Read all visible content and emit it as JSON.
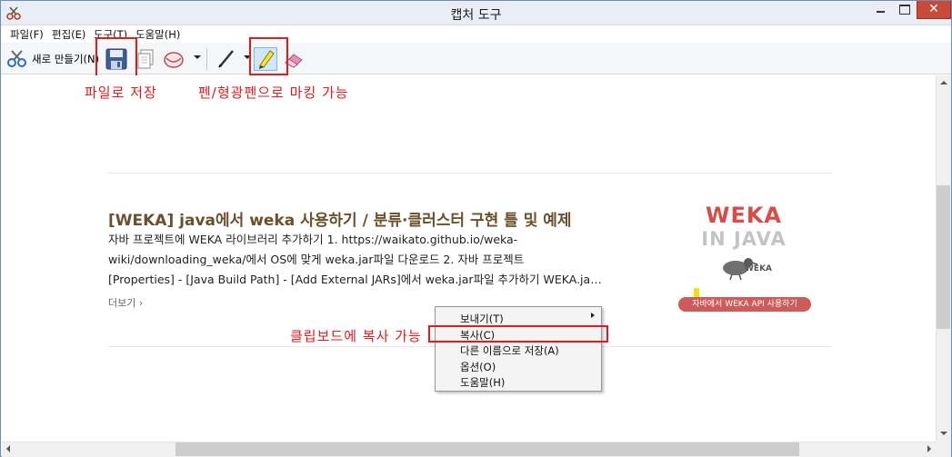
{
  "window": {
    "title": "캡처 도구",
    "close_glyph": "✕"
  },
  "menu": {
    "items": [
      "파일(F)",
      "편집(E)",
      "도구(T)",
      "도움말(H)"
    ]
  },
  "toolbar": {
    "new_label": "새로 만들기(N)"
  },
  "annotations": {
    "save_note": "파일로 저장",
    "pen_note": "펜/형광펜으로 마킹 가능",
    "clipboard_note": "클립보드에 복사 가능"
  },
  "post": {
    "title": "[WEKA] java에서 weka 사용하기 / 분류·클러스터 구현 틀 및 예제",
    "lines": [
      "자바 프로젝트에 WEKA 라이브러리 추가하기 1. https://waikato.github.io/weka-",
      "wiki/downloading_weka/에서 OS에 맞게 weka.jar파일 다운로드 2. 자바 프로젝트",
      "[Properties] - [Java Build Path] - [Add External JARs]에서 weka.jar파일 추가하기 WEKA.ja…"
    ],
    "more_link": "더보기 ›",
    "thumbnail": {
      "title_top": "WEKA",
      "title_bottom": "IN JAVA",
      "logo_label": "WEKA",
      "banner": "자바에서 WEKA API 사용하기"
    }
  },
  "context_menu": {
    "items": [
      "보내기(T)",
      "복사(C)",
      "다른 이름으로 저장(A)",
      "옵션(O)",
      "도움말(H)"
    ]
  },
  "colors": {
    "annotation": "#e5191c",
    "post_title": "#6b4f2a",
    "weka_red": "#d94b46"
  }
}
